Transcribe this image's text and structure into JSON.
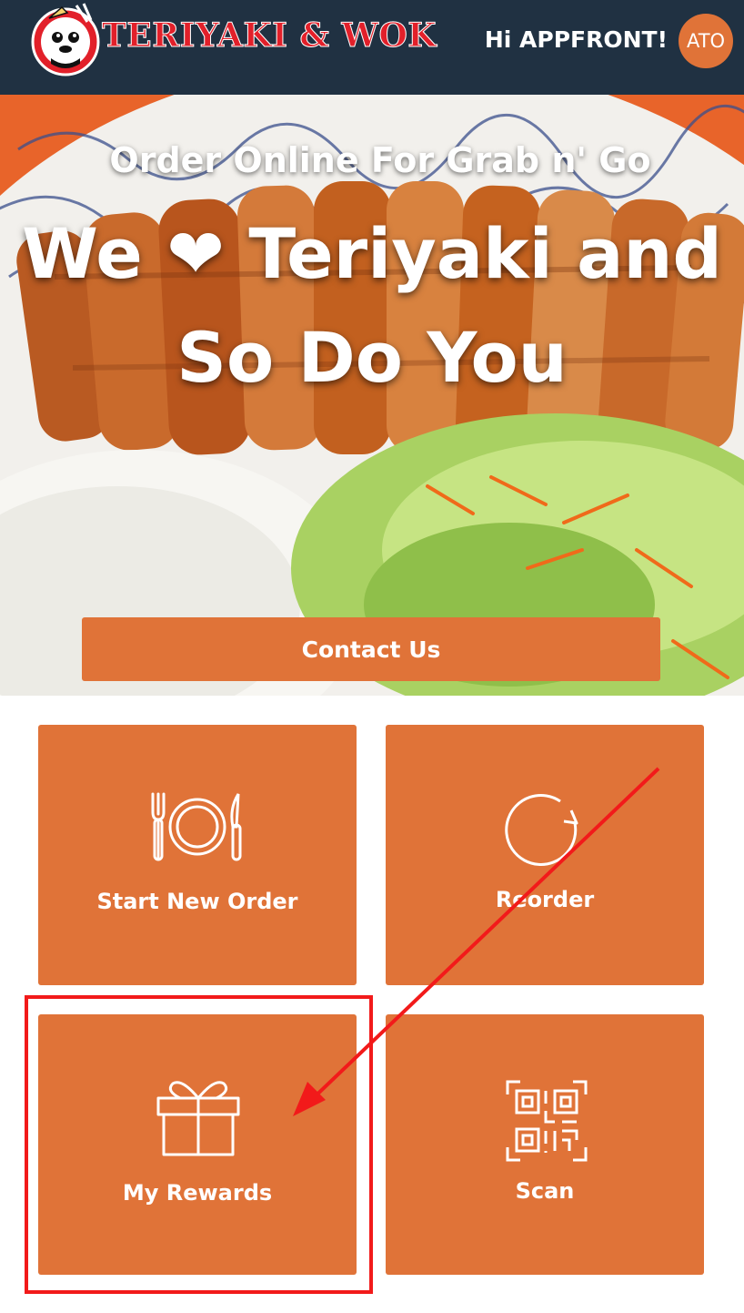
{
  "header": {
    "logo_text": "TERIYAKI & WOK",
    "greeting": "Hi APPFRONT!",
    "avatar_initials": "ATO"
  },
  "hero": {
    "subtitle": "Order Online For Grab n' Go",
    "title": "We ❤ Teriyaki and So Do You",
    "contact_label": "Contact Us"
  },
  "tiles": [
    {
      "label": "Start New Order",
      "icon": "cutlery-plate-icon"
    },
    {
      "label": "Reorder",
      "icon": "reorder-icon"
    },
    {
      "label": "My Rewards",
      "icon": "gift-icon"
    },
    {
      "label": "Scan",
      "icon": "qr-code-icon"
    }
  ],
  "colors": {
    "header_bg": "#203142",
    "accent": "#e07338",
    "annotation": "#f21a1a",
    "logo_red": "#e2202a"
  }
}
